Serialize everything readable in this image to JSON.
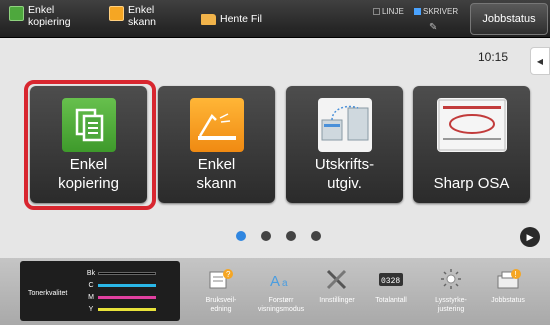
{
  "topbar": {
    "shortcut_copy": "Enkel\nkopiering",
    "shortcut_scan": "Enkel\nskann",
    "shortcut_file": "Hente Fil",
    "status_line": "LINJE",
    "status_printer": "SKRIVER",
    "job_status": "Jobbstatus"
  },
  "clock": "10:15",
  "tiles": [
    {
      "label": "Enkel\nkopiering",
      "icon": "copy-icon",
      "selected": true
    },
    {
      "label": "Enkel\nskann",
      "icon": "scan-icon"
    },
    {
      "label": "Utskrifts-\nutgiv.",
      "icon": "print-release-icon"
    },
    {
      "label": "Sharp OSA",
      "icon": "sharp-osa-icon"
    }
  ],
  "pager": {
    "pages": 4,
    "active": 1
  },
  "toner": {
    "title": "Tonerkvalitet",
    "channels": [
      {
        "name": "Bk",
        "color": "#111111"
      },
      {
        "name": "C",
        "color": "#2ab7e8"
      },
      {
        "name": "M",
        "color": "#e040a0"
      },
      {
        "name": "Y",
        "color": "#e8e23a"
      }
    ]
  },
  "bottom_buttons": [
    {
      "label": "Bruksveil-\nedning",
      "icon": "manual-icon"
    },
    {
      "label": "Forstørr\nvisningsmodus",
      "icon": "magnify-text-icon"
    },
    {
      "label": "Innstillinger",
      "icon": "settings-tools-icon"
    },
    {
      "label": "Totalantall",
      "icon": "counter-icon"
    },
    {
      "label": "Lysstyrke-\njustering",
      "icon": "brightness-icon"
    },
    {
      "label": "Jobbstatus",
      "icon": "job-status-icon"
    }
  ],
  "colors": {
    "selection": "#d8262f",
    "active_dot": "#2f86e0"
  }
}
